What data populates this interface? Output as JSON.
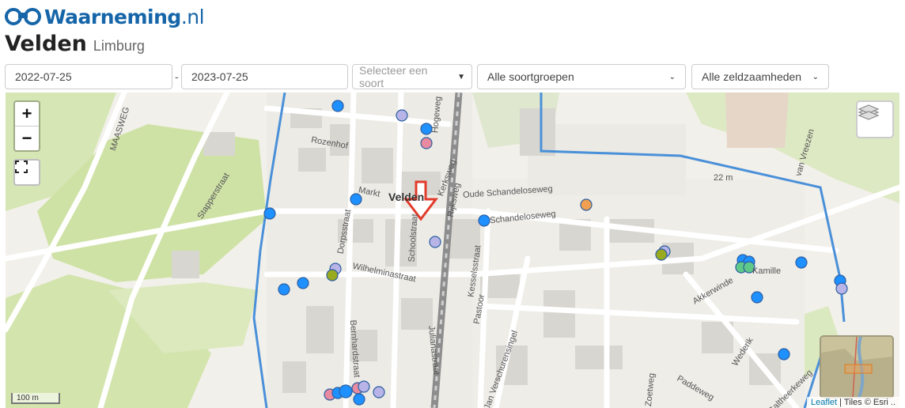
{
  "header": {
    "brand": "Waarneming",
    "brand_tld": ".nl",
    "title": "Velden",
    "subtitle": "Limburg"
  },
  "filters": {
    "date_from": "2022-07-25",
    "date_to": "2023-07-25",
    "date_separator": "-",
    "species_placeholder": "Selecteer een soort",
    "species_group": "Alle soortgroepen",
    "rarity": "Alle zeldzaamheden"
  },
  "map": {
    "zoom_in": "+",
    "zoom_out": "−",
    "scale_label": "100 m",
    "attribution_leaflet": "Leaflet",
    "attribution_tiles": " | Tiles © Esri ..",
    "place_name": "Velden",
    "elevation_label": "22 m",
    "street_labels": [
      "MAASWEG",
      "Rozenhof",
      "Markt",
      "Stapperstraat",
      "Dorpsstraat",
      "Schoolstraat",
      "Hogeweg",
      "Rijksweg",
      "Kerksweg",
      "Oude Schandeloseweg",
      "Schandeloseweg",
      "Wilhelminastraat",
      "Kesselsstraat",
      "Pastoor",
      "Julianastraat",
      "Bernhardstraat",
      "Jan Verschurensingel",
      "Akkerwinde",
      "Wederik",
      "Paddeweg",
      "Zoetweg",
      "van Vreezen",
      "Kamille",
      "Galtheerkeweg"
    ],
    "colors": {
      "boundary": "#4a90d9",
      "obs_blue": "#1e90ff",
      "obs_lavender": "#b8b4e8",
      "obs_pink": "#e88aa0",
      "obs_orange": "#f0a050",
      "obs_olive": "#9aaa20",
      "obs_green": "#5fc98a",
      "arrow": "#e23b2b"
    }
  }
}
